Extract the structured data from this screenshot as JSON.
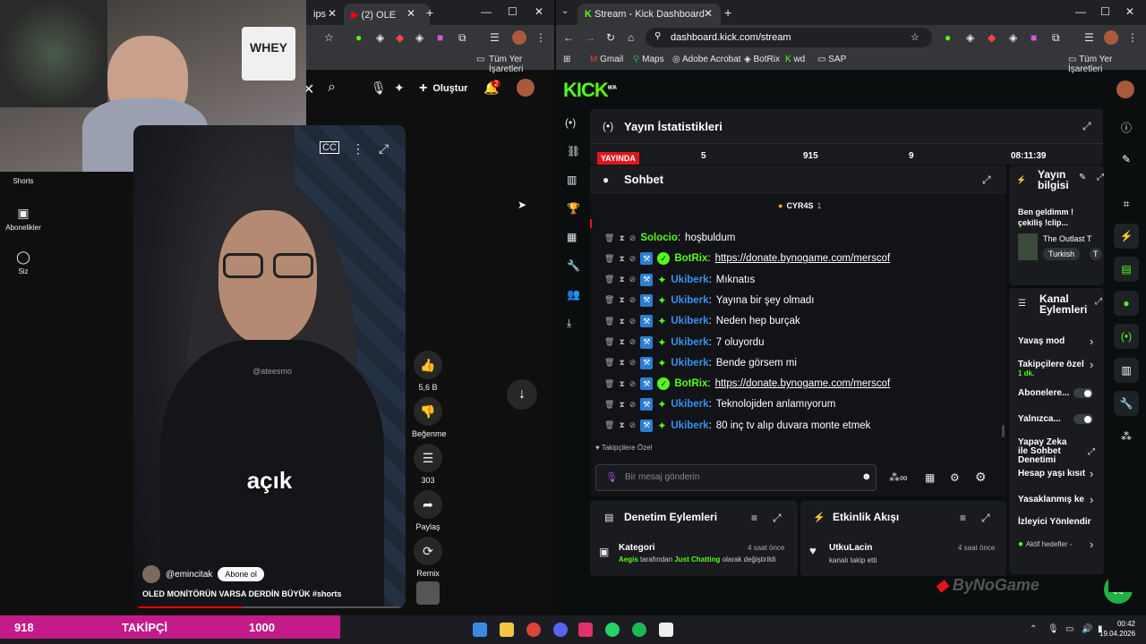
{
  "left_browser": {
    "tab1_title": "ips",
    "tab2_title": "(2) OLE",
    "bookmarks_all": "Tüm Yer İşaretleri"
  },
  "youtube": {
    "create_label": "Oluştur",
    "notif_count": "2",
    "sidebar": [
      {
        "label": "Shorts",
        "icon": "shorts-icon"
      },
      {
        "label": "Abonelikler",
        "icon": "subscriptions-icon"
      },
      {
        "label": "Siz",
        "icon": "profile-icon"
      }
    ],
    "short": {
      "caption_word": "açık",
      "channel": "@emincitak",
      "subscribe": "Abone ol",
      "title": "OLED MONİTÖRÜN VARSA DERDİN BÜYÜK #shorts",
      "shirt_text": "@ateesmo"
    },
    "rail": {
      "likes": "5,6 B",
      "dislike": "Beğenme",
      "comments": "303",
      "share": "Paylaş",
      "remix": "Remix"
    }
  },
  "right_browser": {
    "tab_title": "Stream - Kick Dashboard",
    "url": "dashboard.kick.com/stream",
    "bookmarks": [
      "Gmail",
      "Maps",
      "Adobe Acrobat",
      "BotRix",
      "wd",
      "SAP"
    ],
    "bookmarks_all": "Tüm Yer İşaretleri"
  },
  "kick": {
    "logo": "KICK",
    "logo_sup": "BETA",
    "stats": {
      "title": "Yayın İstatistikleri",
      "live_badge": "YAYINDA",
      "values": [
        "5",
        "915",
        "9",
        "08:11:39"
      ]
    },
    "chat": {
      "title": "Sohbet",
      "pinned_user": "CYR4S",
      "pinned_count": "1",
      "messages": [
        {
          "user": "Solocio",
          "text": "hoşbuldum",
          "color": "green",
          "badges": 0,
          "link": false
        },
        {
          "user": "BotRix",
          "text": "https://donate.bynogame.com/merscof",
          "color": "green",
          "badges": 2,
          "link": true
        },
        {
          "user": "Ukiberk",
          "text": "Mıknatıs",
          "color": "blue",
          "badges": 1,
          "link": false
        },
        {
          "user": "Ukiberk",
          "text": "Yayına bir şey olmadı",
          "color": "blue",
          "badges": 1,
          "link": false
        },
        {
          "user": "Ukiberk",
          "text": "Neden hep burçak",
          "color": "blue",
          "badges": 1,
          "link": false
        },
        {
          "user": "Ukiberk",
          "text": "7 oluyordu",
          "color": "blue",
          "badges": 1,
          "link": false
        },
        {
          "user": "Ukiberk",
          "text": "Bende görsem mi",
          "color": "blue",
          "badges": 1,
          "link": false
        },
        {
          "user": "BotRix",
          "text": "https://donate.bynogame.com/merscof",
          "color": "green",
          "badges": 2,
          "link": true
        },
        {
          "user": "Ukiberk",
          "text": "Teknolojiden anlamıyorum",
          "color": "blue",
          "badges": 1,
          "link": false
        },
        {
          "user": "Ukiberk",
          "text": "80 inç tv alıp duvara monte etmek",
          "color": "blue",
          "badges": 1,
          "link": false
        }
      ],
      "followers_only": "Takipçilere Özel",
      "input_placeholder": "Bir mesaj gönderin"
    },
    "stream_info": {
      "title": "Yayın bilgisi",
      "stream_title": "Ben geldimm ! çekiliş !clip...",
      "game": "The Outlast T",
      "tag": "Turkish",
      "tag2": "T"
    },
    "channel_actions": {
      "title": "Kanal Eylemleri",
      "items": [
        {
          "label": "Yavaş mod",
          "control": "chevron"
        },
        {
          "label": "Takipçilere özel",
          "sub": "1 dk.",
          "control": "chevron"
        },
        {
          "label": "Abonelere...",
          "control": "toggle"
        },
        {
          "label": "Yalnızca...",
          "control": "toggle"
        },
        {
          "label": "Yapay Zeka ile Sohbet Denetimi",
          "control": "external"
        },
        {
          "label": "Hesap yaşı kısıt",
          "control": "chevron"
        },
        {
          "label": "Yasaklanmış ke",
          "control": "chevron"
        },
        {
          "label": "İzleyici Yönlendir",
          "control": "none"
        },
        {
          "label": "Aktif hedefler -",
          "control": "chevron",
          "dot": true
        }
      ]
    },
    "moderation": {
      "title": "Denetim Eylemleri",
      "item_title": "Kategori",
      "item_time": "4 saat önce",
      "item_user": "Aegis",
      "item_mid": "tarafından",
      "item_cat": "Just Chatting",
      "item_end": "olarak değiştirildi"
    },
    "activity": {
      "title": "Etkinlik Akışı",
      "item_user": "UtkuLacin",
      "item_time": "4 saat önce",
      "item_desc": "kanalı takip etti"
    }
  },
  "overlay": {
    "follow_count": "918",
    "follow_label": "TAKİPÇİ",
    "follow_goal": "1000",
    "watermark": "ByNoGame"
  },
  "taskbar": {
    "time": "00:42",
    "date": "19.04.2026"
  },
  "colors": {
    "kick_green": "#53fc18",
    "follow_bar": "#c41b8a",
    "live_red": "#e0161e"
  }
}
